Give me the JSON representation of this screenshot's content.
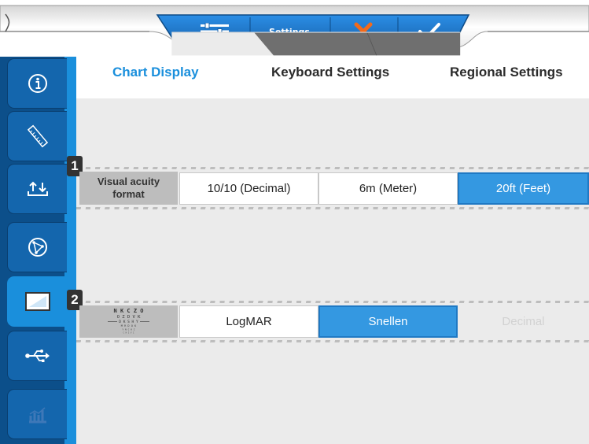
{
  "toolbar": {
    "settings_label": "Settings",
    "buttons": {
      "settings": "sliders-icon",
      "cancel": "x-icon",
      "confirm": "check-icon"
    },
    "colors": {
      "blue": "#1a6fc0",
      "cancel": "#f26a1b",
      "confirm": "#1a6fc0"
    }
  },
  "sidebar": {
    "items": [
      {
        "icon": "info-icon"
      },
      {
        "icon": "ruler-icon"
      },
      {
        "icon": "upload-download-icon"
      },
      {
        "icon": "compass-icon"
      },
      {
        "icon": "display-icon",
        "active": true
      },
      {
        "icon": "usb-icon"
      },
      {
        "icon": "chart-icon",
        "disabled": true
      }
    ]
  },
  "tabs": [
    {
      "label": "Chart Display",
      "active": true
    },
    {
      "label": "Keyboard Settings"
    },
    {
      "label": "Regional Settings"
    }
  ],
  "rows": [
    {
      "number": "1",
      "label_line1": "Visual acuity",
      "label_line2": "format",
      "options": [
        {
          "label": "10/10 (Decimal)"
        },
        {
          "label": "6m (Meter)"
        },
        {
          "label": "20ft (Feet)",
          "selected": true
        }
      ]
    },
    {
      "number": "2",
      "label_icon": "eye-chart-icon",
      "chart_letters": [
        "N K C Z O",
        "O Z D V K",
        "D K S H Y",
        "M R D O K",
        "Y N C K I",
        "C H I V I"
      ],
      "options": [
        {
          "label": "LogMAR"
        },
        {
          "label": "Snellen",
          "selected": true
        },
        {
          "label": "Decimal",
          "disabled": true
        }
      ]
    }
  ],
  "colors": {
    "accent": "#1a8fdc",
    "selected": "#3498e1",
    "sidebar_dark": "#0c4f8a"
  }
}
